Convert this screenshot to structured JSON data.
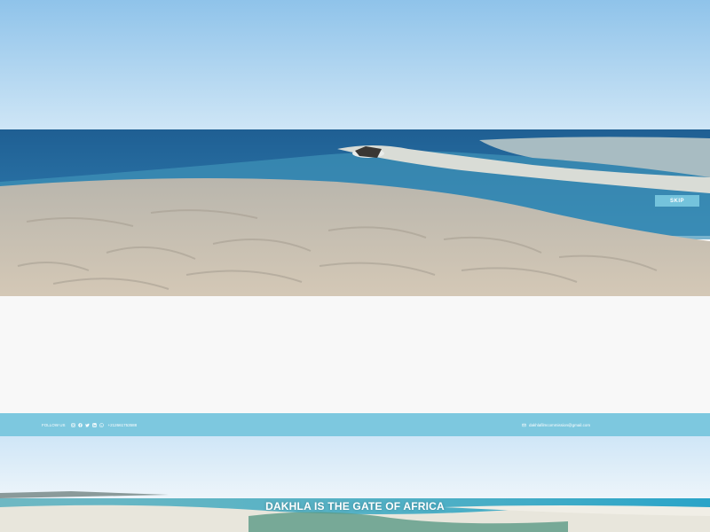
{
  "video": {
    "skip_label": "SKIP"
  },
  "topbar": {
    "follow_label": "FOLLOW US",
    "social_icons": [
      "instagram-icon",
      "facebook-icon",
      "twitter-icon",
      "linkedin-icon",
      "whatsapp-icon"
    ],
    "phone": "+212661753588",
    "email": "dakhlafilmcommission@gmail.com",
    "bg_color": "#7dc8df"
  },
  "hero": {
    "title": "DAKHLA IS THE GATE OF AFRICA"
  }
}
